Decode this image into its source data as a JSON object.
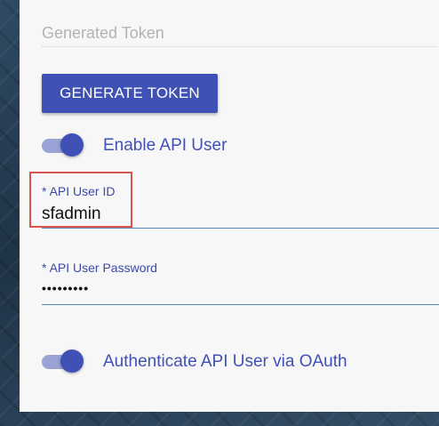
{
  "generated_token": {
    "placeholder": "Generated Token",
    "value": ""
  },
  "generate_button": {
    "label": "GENERATE TOKEN"
  },
  "enable_api_user": {
    "label": "Enable API User",
    "checked": true
  },
  "api_user_id": {
    "label": "* API User ID",
    "value": "sfadmin"
  },
  "api_user_password": {
    "label": "* API User Password",
    "value": "•••••••••"
  },
  "oauth_toggle": {
    "label": "Authenticate API User via OAuth",
    "checked": true
  },
  "colors": {
    "accent": "#3f51b5",
    "toggle_track": "#9aa3d6",
    "highlight": "#d9534f",
    "field_underline": "#5b87b5"
  }
}
